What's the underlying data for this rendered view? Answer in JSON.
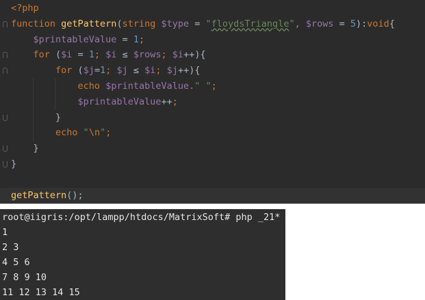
{
  "editor": {
    "lines": [
      [
        {
          "t": "<?php",
          "c": "kw"
        }
      ],
      [
        {
          "t": "function ",
          "c": "kw"
        },
        {
          "t": "getPattern",
          "c": "fn"
        },
        {
          "t": "(",
          "c": "plain"
        },
        {
          "t": "string ",
          "c": "kw"
        },
        {
          "t": "$type",
          "c": "var"
        },
        {
          "t": " = ",
          "c": "plain"
        },
        {
          "t": "\"",
          "c": "str"
        },
        {
          "t": "floydsTriangle",
          "c": "str typo"
        },
        {
          "t": "\"",
          "c": "str"
        },
        {
          "t": ", ",
          "c": "kw"
        },
        {
          "t": "$rows",
          "c": "var"
        },
        {
          "t": " = ",
          "c": "plain"
        },
        {
          "t": "5",
          "c": "num"
        },
        {
          "t": "):",
          "c": "plain"
        },
        {
          "t": "void",
          "c": "kw"
        },
        {
          "t": "{",
          "c": "plain"
        }
      ],
      [
        {
          "t": "    ",
          "c": "plain"
        },
        {
          "t": "$printableValue",
          "c": "var"
        },
        {
          "t": " = ",
          "c": "plain"
        },
        {
          "t": "1",
          "c": "num"
        },
        {
          "t": ";",
          "c": "kw"
        }
      ],
      [
        {
          "t": "    ",
          "c": "plain"
        },
        {
          "t": "for",
          "c": "kw"
        },
        {
          "t": " (",
          "c": "plain"
        },
        {
          "t": "$i",
          "c": "var"
        },
        {
          "t": " = ",
          "c": "plain"
        },
        {
          "t": "1",
          "c": "num"
        },
        {
          "t": "; ",
          "c": "kw"
        },
        {
          "t": "$i",
          "c": "var"
        },
        {
          "t": " ≤ ",
          "c": "plain"
        },
        {
          "t": "$rows",
          "c": "var"
        },
        {
          "t": "; ",
          "c": "kw"
        },
        {
          "t": "$i",
          "c": "var"
        },
        {
          "t": "++",
          "c": "plain"
        },
        {
          "t": "){",
          "c": "plain"
        }
      ],
      [
        {
          "t": "        ",
          "c": "plain"
        },
        {
          "t": "for",
          "c": "kw"
        },
        {
          "t": " (",
          "c": "plain"
        },
        {
          "t": "$j",
          "c": "var"
        },
        {
          "t": "=",
          "c": "plain"
        },
        {
          "t": "1",
          "c": "num"
        },
        {
          "t": "; ",
          "c": "kw"
        },
        {
          "t": "$j",
          "c": "var"
        },
        {
          "t": " ≤ ",
          "c": "plain"
        },
        {
          "t": "$i",
          "c": "var"
        },
        {
          "t": "; ",
          "c": "kw"
        },
        {
          "t": "$j",
          "c": "var"
        },
        {
          "t": "++",
          "c": "plain"
        },
        {
          "t": "){",
          "c": "plain"
        }
      ],
      [
        {
          "t": "            ",
          "c": "plain"
        },
        {
          "t": "echo ",
          "c": "kw"
        },
        {
          "t": "$printableValue",
          "c": "var"
        },
        {
          "t": ".",
          "c": "kw"
        },
        {
          "t": "\" \"",
          "c": "str"
        },
        {
          "t": ";",
          "c": "kw"
        }
      ],
      [
        {
          "t": "            ",
          "c": "plain"
        },
        {
          "t": "$printableValue",
          "c": "var"
        },
        {
          "t": "++",
          "c": "plain"
        },
        {
          "t": ";",
          "c": "kw"
        }
      ],
      [
        {
          "t": "        ",
          "c": "plain"
        },
        {
          "t": "}",
          "c": "plain"
        }
      ],
      [
        {
          "t": "        ",
          "c": "plain"
        },
        {
          "t": "echo ",
          "c": "kw"
        },
        {
          "t": "\"",
          "c": "str"
        },
        {
          "t": "\\n",
          "c": "kw"
        },
        {
          "t": "\"",
          "c": "str"
        },
        {
          "t": ";",
          "c": "kw"
        }
      ],
      [
        {
          "t": "    ",
          "c": "plain"
        },
        {
          "t": "}",
          "c": "plain"
        }
      ],
      [
        {
          "t": "}",
          "c": "plain"
        }
      ],
      [],
      [
        {
          "t": "getPattern",
          "c": "fn"
        },
        {
          "t": "();",
          "c": "plain"
        }
      ]
    ]
  },
  "terminal": {
    "prompt": "root@iigris:/opt/lampp/htdocs/MatrixSoft# php _21*",
    "output": [
      "1",
      "2 3",
      "4 5 6",
      "7 8 9 10",
      "11 12 13 14 15"
    ]
  }
}
